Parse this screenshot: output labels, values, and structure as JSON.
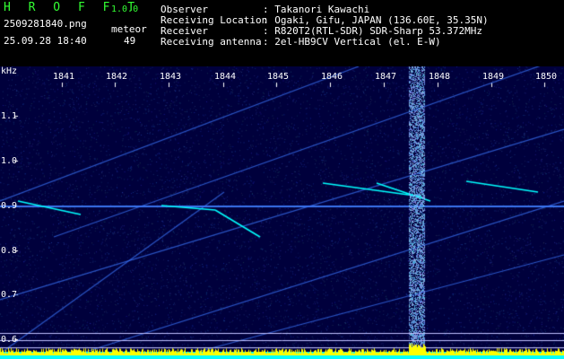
{
  "app": {
    "name": "H R O F F T",
    "version": "1.0.0",
    "filename": "2509281840.png",
    "datetime": "25.09.28 18:40",
    "meteor_label": "meteor",
    "meteor_count": "49"
  },
  "info": {
    "rows": [
      {
        "label": "Observer",
        "value": ": Takanori Kawachi"
      },
      {
        "label": "Receiving Location",
        "value": ": Ogaki, Gifu, JAPAN (136.60E, 35.35N)"
      },
      {
        "label": "Receiver",
        "value": ": R820T2(RTL-SDR) SDR-Sharp 53.372MHz"
      },
      {
        "label": "Receiving antenna",
        "value": ": 2el-HB9CV Vertical (el. E-W)"
      }
    ]
  },
  "axis": {
    "unit": "kHz",
    "freq_labels": [
      "1.1",
      "1.0",
      "0.9",
      "0.8",
      "0.7",
      "0.6"
    ],
    "time_labels": [
      "1841",
      "1842",
      "1843",
      "1844",
      "1845",
      "1846",
      "1847",
      "1848",
      "1849",
      "1850"
    ]
  },
  "colors": {
    "header_green": "#33ff33",
    "background": "#00003c",
    "meteor_echo": "#00ffff",
    "intense_echo": "#ffff00",
    "carrier": "#4080ff"
  }
}
